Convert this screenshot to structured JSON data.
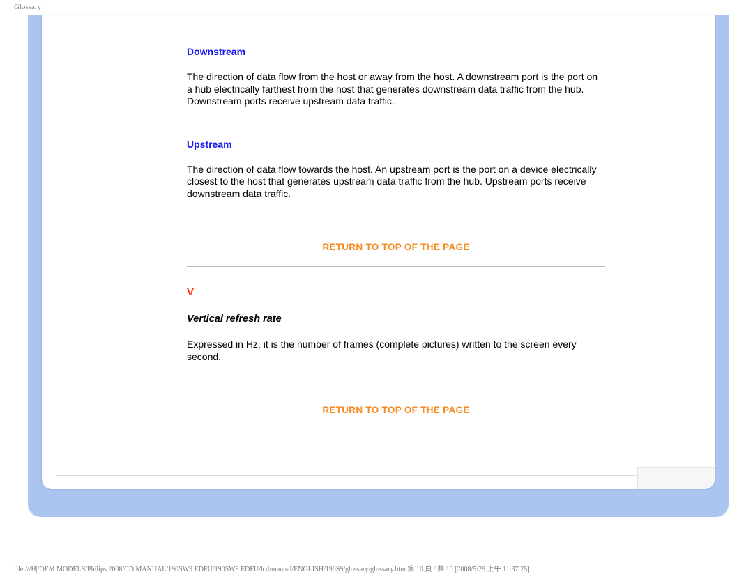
{
  "header": {
    "label": "Glossary"
  },
  "content": {
    "term1": {
      "title": "Downstream",
      "body": "The direction of data flow from the host or away from the host. A downstream port is the port on a hub electrically farthest from the host that generates downstream data traffic from the hub. Downstream ports receive upstream data traffic."
    },
    "term2": {
      "title": "Upstream",
      "body": "The direction of data flow towards the host. An upstream port is the port on a device electrically closest to the host that generates upstream data traffic from the hub. Upstream ports receive downstream data traffic."
    },
    "return_link": "RETURN TO TOP OF THE PAGE",
    "section_letter": "V",
    "sub": {
      "heading": "Vertical refresh rate",
      "body": "Expressed in Hz, it is the number of frames (complete pictures) written to the screen every second."
    }
  },
  "footer": {
    "path": "file:///H|/OEM MODELS/Philips 2008/CD MANUAL/190SW9 EDFU/190SW9 EDFU/lcd/manual/ENGLISH/190S9/glossary/glossary.htm 第 10 頁 / 共 10  [2008/5/29 上午 11:37:25]"
  }
}
